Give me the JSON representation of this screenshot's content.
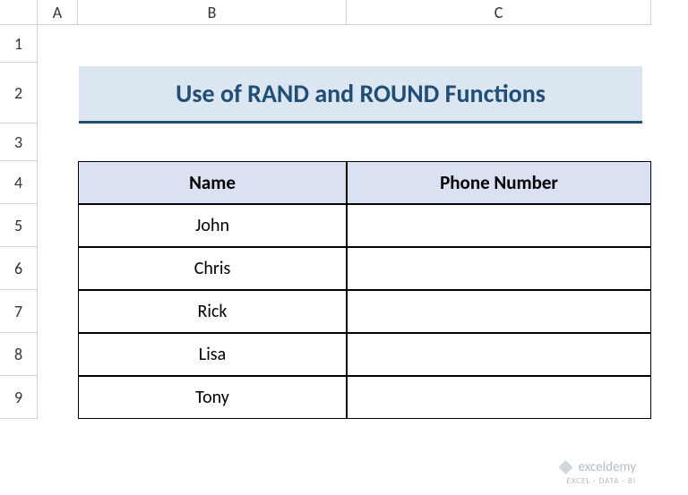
{
  "columns": [
    "A",
    "B",
    "C"
  ],
  "rows": [
    "1",
    "2",
    "3",
    "4",
    "5",
    "6",
    "7",
    "8",
    "9"
  ],
  "title": "Use of RAND and ROUND Functions",
  "table": {
    "headers": {
      "name": "Name",
      "phone": "Phone Number"
    },
    "rows": [
      {
        "name": "John",
        "phone": ""
      },
      {
        "name": "Chris",
        "phone": ""
      },
      {
        "name": "Rick",
        "phone": ""
      },
      {
        "name": "Lisa",
        "phone": ""
      },
      {
        "name": "Tony",
        "phone": ""
      }
    ]
  },
  "watermark": {
    "brand": "exceldemy",
    "tagline": "EXCEL · DATA · BI"
  }
}
